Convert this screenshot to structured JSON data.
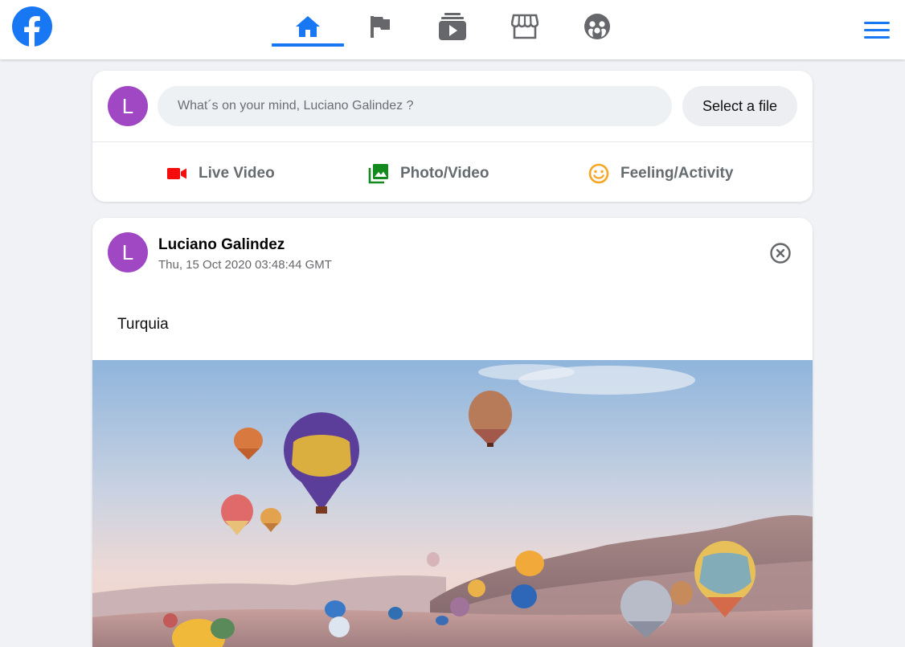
{
  "nav": {
    "logo": "facebook-logo",
    "tabs": [
      {
        "icon": "home-icon",
        "active": true
      },
      {
        "icon": "flag-icon",
        "active": false
      },
      {
        "icon": "video-icon",
        "active": false
      },
      {
        "icon": "marketplace-icon",
        "active": false
      },
      {
        "icon": "groups-icon",
        "active": false
      }
    ],
    "menu_icon": "hamburger-menu-icon",
    "accent_color": "#1877f2"
  },
  "composer": {
    "avatar_initial": "L",
    "avatar_color": "#a047c4",
    "placeholder": "What´s on your mind, Luciano Galindez ?",
    "select_file_label": "Select a file",
    "actions": [
      {
        "label": "Live Video",
        "icon": "live-video-icon",
        "color": "#f02849"
      },
      {
        "label": "Photo/Video",
        "icon": "photo-video-icon",
        "color": "#138a1d"
      },
      {
        "label": "Feeling/Activity",
        "icon": "feeling-icon",
        "color": "#f5a623"
      }
    ]
  },
  "post": {
    "avatar_initial": "L",
    "author": "Luciano Galindez",
    "timestamp": "Thu, 15 Oct 2020 03:48:44 GMT",
    "text": "Turquia",
    "image_subject": "hot air balloons over Cappadocia valley"
  }
}
